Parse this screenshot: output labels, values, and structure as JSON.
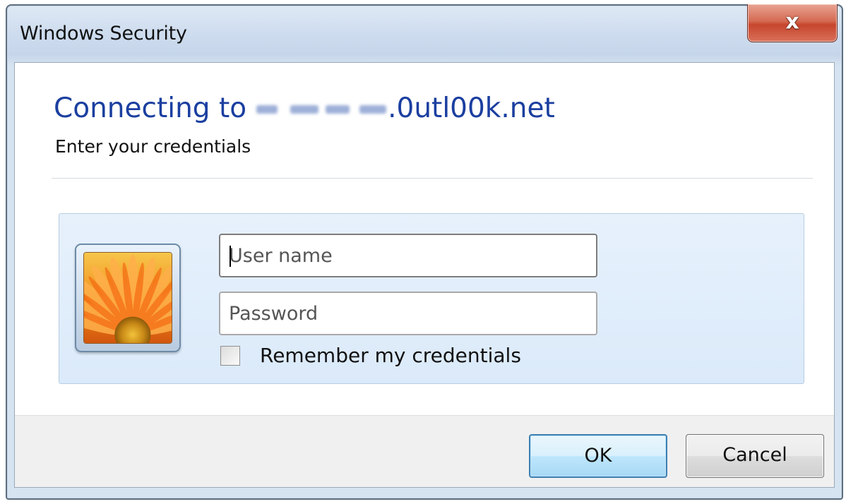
{
  "window": {
    "title": "Windows Security",
    "close_symbol": "x"
  },
  "prompt": {
    "connecting_prefix": "Connecting to",
    "server_suffix": ".0utl00k.net",
    "instruction": "Enter your credentials"
  },
  "form": {
    "username_placeholder": "User name",
    "password_placeholder": "Password",
    "remember_label": "Remember my credentials",
    "remember_checked": false
  },
  "buttons": {
    "ok_label": "OK",
    "cancel_label": "Cancel"
  },
  "colors": {
    "heading": "#1b3fa0",
    "panel": "#dbeafa",
    "close_button": "#c7452d"
  },
  "icons": {
    "user_tile": "flower-user-picture-icon",
    "close": "close-icon"
  }
}
